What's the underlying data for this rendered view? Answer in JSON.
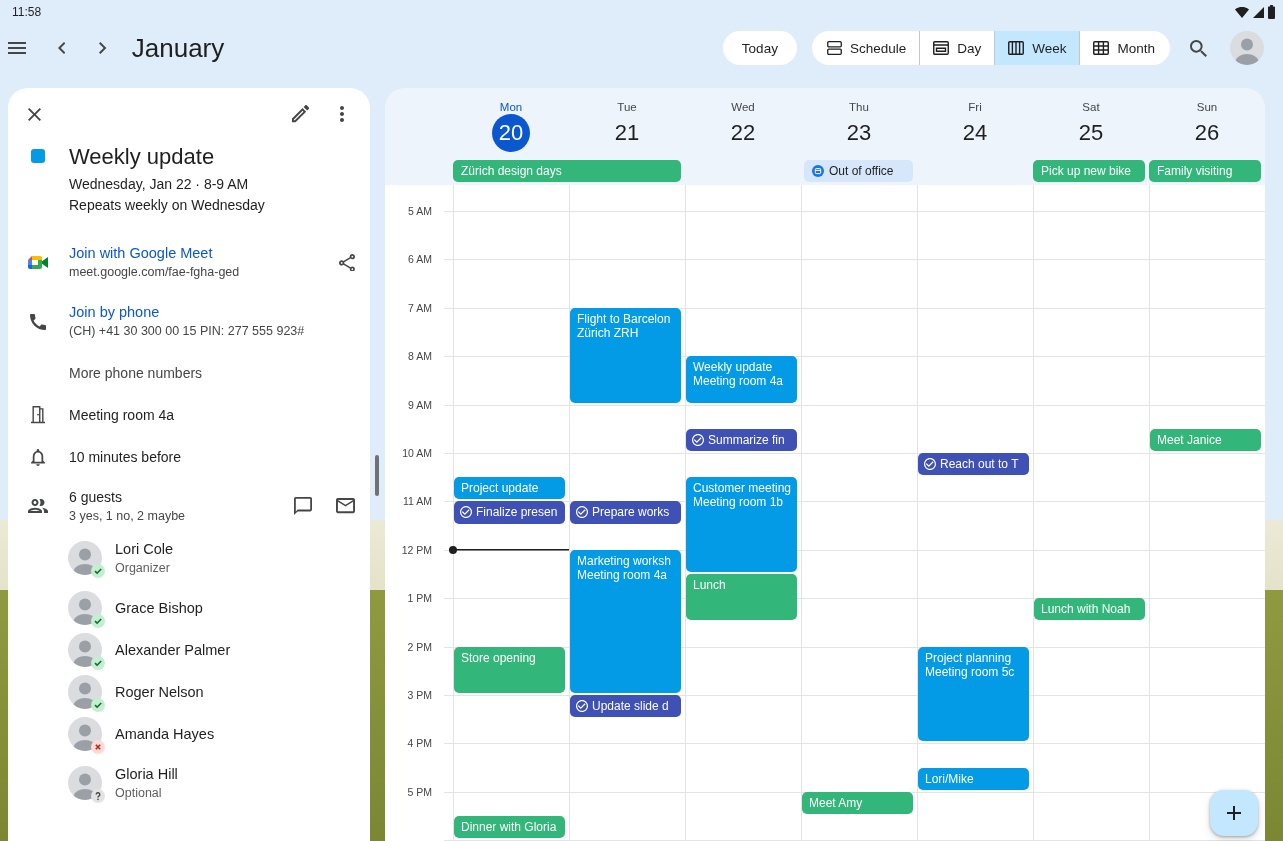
{
  "status_bar": {
    "time": "11:58"
  },
  "top_bar": {
    "title": "January",
    "today_button": "Today",
    "views": [
      {
        "kind": "schedule",
        "label": "Schedule",
        "selected": false
      },
      {
        "kind": "day",
        "label": "Day",
        "selected": false
      },
      {
        "kind": "week",
        "label": "Week",
        "selected": true
      },
      {
        "kind": "month",
        "label": "Month",
        "selected": false
      }
    ]
  },
  "event_details": {
    "title": "Weekly update",
    "color": "#039be5",
    "when": "Wednesday, Jan 22 · 8-9 AM",
    "recurrence": "Repeats weekly on Wednesday",
    "rows": [
      {
        "kind": "video_call",
        "title": "Join with Google Meet",
        "detail": "meet.google.com/fae-fgha-ged"
      },
      {
        "kind": "phone",
        "title": "Join by phone",
        "detail": "(CH) +41 30 300 00 15 PIN: 277 555 923#"
      },
      {
        "kind": "more_numbers",
        "title": "More phone numbers"
      },
      {
        "kind": "room",
        "title": "Meeting room 4a"
      },
      {
        "kind": "reminder",
        "title": "10 minutes before"
      }
    ],
    "guests_summary": {
      "title": "6 guests",
      "detail": "3 yes, 1 no, 2 maybe"
    },
    "guests": [
      {
        "name": "Lori Cole",
        "role": "Organizer",
        "kind": "yes"
      },
      {
        "name": "Grace Bishop",
        "kind": "yes"
      },
      {
        "name": "Alexander Palmer",
        "kind": "yes"
      },
      {
        "name": "Roger Nelson",
        "kind": "yes"
      },
      {
        "name": "Amanda Hayes",
        "kind": "no"
      },
      {
        "name": "Gloria Hill",
        "role": "Optional",
        "kind": "maybe"
      }
    ]
  },
  "calendar": {
    "hours": [
      "5 AM",
      "6 AM",
      "7 AM",
      "8 AM",
      "9 AM",
      "10 AM",
      "11 AM",
      "12 PM",
      "1 PM",
      "2 PM",
      "3 PM",
      "4 PM",
      "5 PM"
    ],
    "days": [
      {
        "weekday": "Mon",
        "date": "20",
        "selected": true,
        "all_day": [
          {
            "kind": "event",
            "title": "Zürich design days",
            "color": "#33b679"
          }
        ],
        "events": [
          {
            "kind": "event",
            "title": "Project update",
            "color": "#039be5"
          },
          {
            "kind": "task",
            "title": "Finalize presen",
            "color": "#3f51b5"
          },
          {
            "kind": "event",
            "title": "Store opening",
            "color": "#33b679"
          },
          {
            "kind": "event",
            "title": "Dinner with Gloria",
            "color": "#33b679"
          }
        ]
      },
      {
        "weekday": "Tue",
        "date": "21",
        "selected": false,
        "events": [
          {
            "kind": "event",
            "title": "Flight to Barcelon",
            "location": "Zürich ZRH",
            "color": "#039be5"
          },
          {
            "kind": "task",
            "title": "Prepare works",
            "color": "#3f51b5"
          },
          {
            "kind": "event",
            "title": "Marketing worksh",
            "location": "Meeting room 4a",
            "color": "#039be5"
          },
          {
            "kind": "task",
            "title": "Update slide d",
            "color": "#3f51b5"
          }
        ]
      },
      {
        "weekday": "Wed",
        "date": "22",
        "selected": false,
        "events": [
          {
            "kind": "event",
            "title": "Weekly update",
            "location": "Meeting room 4a",
            "color": "#039be5"
          },
          {
            "kind": "task",
            "title": "Summarize fin",
            "color": "#3f51b5"
          },
          {
            "kind": "event",
            "title": "Customer meeting",
            "location": "Meeting room 1b",
            "color": "#039be5"
          },
          {
            "kind": "event",
            "title": "Lunch",
            "color": "#33b679"
          }
        ]
      },
      {
        "weekday": "Thu",
        "date": "23",
        "selected": false,
        "all_day": [
          {
            "kind": "out_of_office",
            "title": "Out of office"
          }
        ],
        "events": [
          {
            "kind": "event",
            "title": "Meet Amy",
            "color": "#33b679"
          }
        ]
      },
      {
        "weekday": "Fri",
        "date": "24",
        "selected": false,
        "events": [
          {
            "kind": "task",
            "title": "Reach out to T",
            "color": "#3f51b5"
          },
          {
            "kind": "event",
            "title": "Project planning",
            "location": "Meeting room 5c",
            "color": "#039be5"
          },
          {
            "kind": "event",
            "title": "Lori/Mike",
            "color": "#039be5"
          }
        ]
      },
      {
        "weekday": "Sat",
        "date": "25",
        "selected": false,
        "all_day": [
          {
            "kind": "event",
            "title": "Pick up new bike",
            "color": "#33b679"
          }
        ],
        "events": [
          {
            "kind": "event",
            "title": "Lunch with Noah",
            "color": "#33b679"
          }
        ]
      },
      {
        "weekday": "Sun",
        "date": "26",
        "selected": false,
        "all_day": [
          {
            "kind": "event",
            "title": "Family visiting",
            "color": "#33b679"
          }
        ],
        "events": [
          {
            "kind": "event",
            "title": "Meet Janice",
            "color": "#33b679"
          }
        ]
      }
    ]
  }
}
